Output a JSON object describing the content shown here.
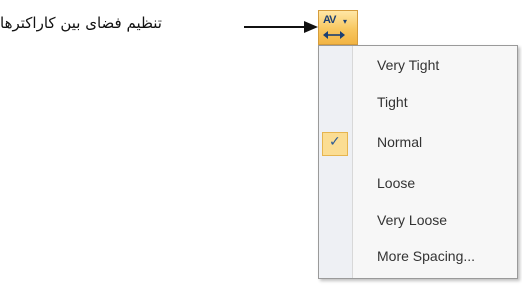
{
  "caption": {
    "text": "تنظیم فضای بین کاراکترها"
  },
  "toolbar": {
    "character_spacing_button": {
      "glyph_label": "AV",
      "icon": "character-spacing-icon",
      "highlight_color": "#f8c760"
    }
  },
  "menu": {
    "items": [
      {
        "label": "Very Tight",
        "checked": false
      },
      {
        "label": "Tight",
        "checked": false
      },
      {
        "label": "Normal",
        "checked": true
      },
      {
        "label": "Loose",
        "checked": false
      },
      {
        "label": "Very Loose",
        "checked": false
      },
      {
        "label": "More Spacing...",
        "checked": false
      }
    ],
    "check_glyph": "✓"
  }
}
